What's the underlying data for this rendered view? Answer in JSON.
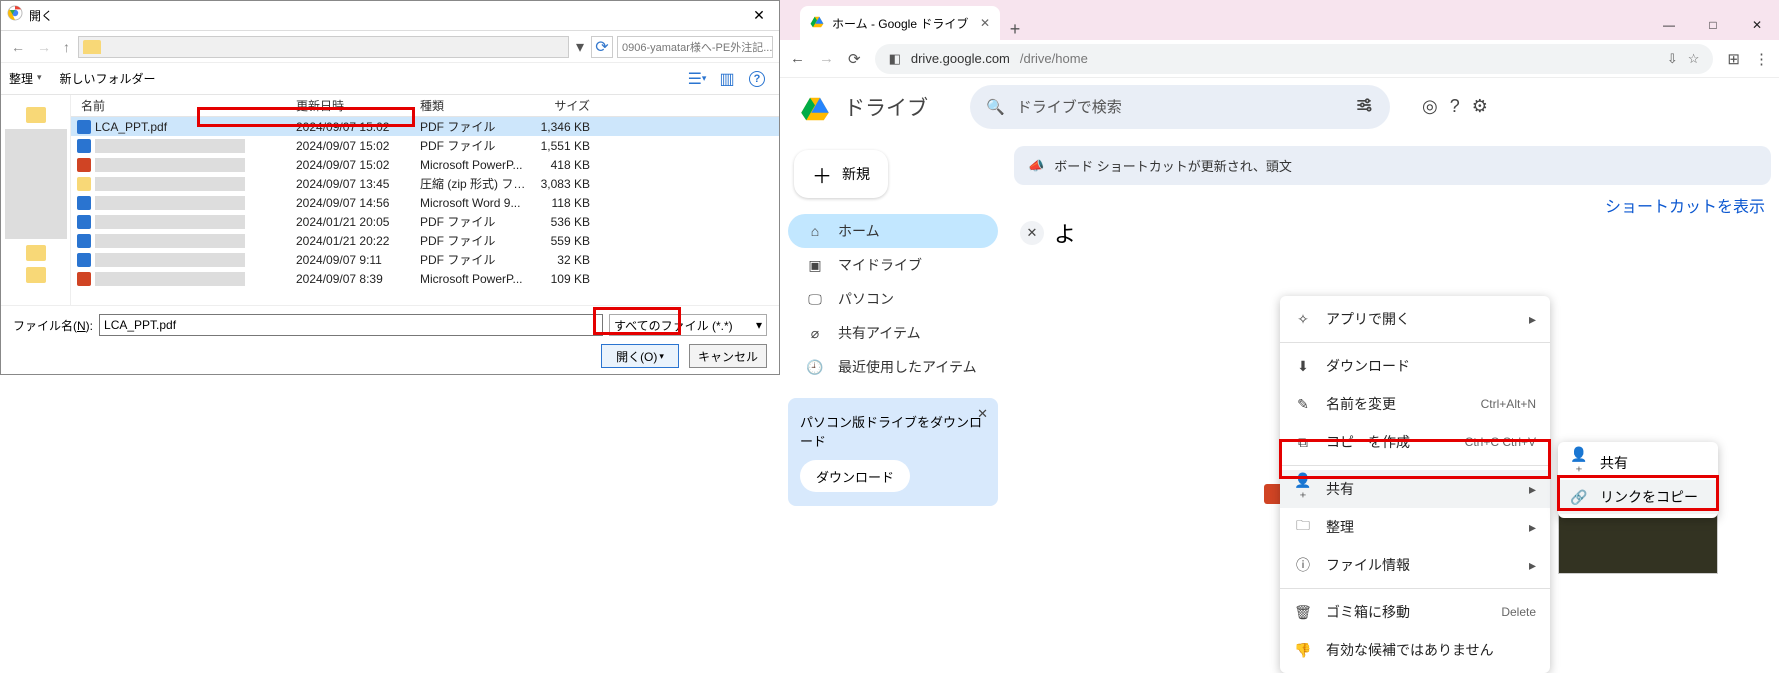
{
  "open_dialog": {
    "title": "開く",
    "nav": {
      "search_placeholder": "0906-yamatar様へ-PE外注記..."
    },
    "toolbar": {
      "organize": "整理",
      "new_folder": "新しいフォルダー"
    },
    "columns": {
      "name": "名前",
      "date": "更新日時",
      "type": "種類",
      "size": "サイズ"
    },
    "files": [
      {
        "name": "LCA_PPT.pdf",
        "date": "2024/09/07 15:02",
        "type": "PDF ファイル",
        "size": "1,346 KB",
        "ico": "pdf",
        "selected": true,
        "show_name": true
      },
      {
        "name": "",
        "date": "2024/09/07 15:02",
        "type": "PDF ファイル",
        "size": "1,551 KB",
        "ico": "pdf"
      },
      {
        "name": "",
        "date": "2024/09/07 15:02",
        "type": "Microsoft PowerP...",
        "size": "418 KB",
        "ico": "ppt"
      },
      {
        "name": "",
        "date": "2024/09/07 13:45",
        "type": "圧縮 (zip 形式) フォ...",
        "size": "3,083 KB",
        "ico": "zip"
      },
      {
        "name": "",
        "date": "2024/09/07 14:56",
        "type": "Microsoft Word 9...",
        "size": "118 KB",
        "ico": "doc"
      },
      {
        "name": "",
        "date": "2024/01/21 20:05",
        "type": "PDF ファイル",
        "size": "536 KB",
        "ico": "pdf"
      },
      {
        "name": "",
        "date": "2024/01/21 20:22",
        "type": "PDF ファイル",
        "size": "559 KB",
        "ico": "pdf"
      },
      {
        "name": "",
        "date": "2024/09/07 9:11",
        "type": "PDF ファイル",
        "size": "32 KB",
        "ico": "pdf"
      },
      {
        "name": "",
        "date": "2024/09/07 8:39",
        "type": "Microsoft PowerP...",
        "size": "109 KB",
        "ico": "ppt"
      }
    ],
    "footer": {
      "file_name_label": "ファイル名(N):",
      "file_name_value": "LCA_PPT.pdf",
      "type_filter": "すべてのファイル (*.*)",
      "open": "開く(O)",
      "cancel": "キャンセル"
    }
  },
  "chrome": {
    "tab_title": "ホーム - Google ドライブ",
    "url_host": "drive.google.com",
    "url_path": "/drive/home"
  },
  "drive": {
    "brand": "ドライブ",
    "search_placeholder": "ドライブで検索",
    "new_button": "新規",
    "side": [
      {
        "icon": "⌂",
        "label": "ホーム",
        "active": true
      },
      {
        "icon": "▣",
        "label": "マイドライブ"
      },
      {
        "icon": "🖵",
        "label": "パソコン"
      },
      {
        "icon": "⌀",
        "label": "共有アイテム"
      },
      {
        "icon": "🕘",
        "label": "最近使用したアイテム"
      }
    ],
    "promo": {
      "text": "パソコン版ドライブをダウンロード",
      "button": "ダウンロード"
    },
    "info_bar_tail": "ボード ショートカットが更新され、頭文",
    "shortcut_link": "ショートカットを表示",
    "welcome_prefix": "よ"
  },
  "ctx": {
    "open_with": "アプリで開く",
    "download": "ダウンロード",
    "rename": "名前を変更",
    "rename_kb": "Ctrl+Alt+N",
    "make_copy": "コピーを作成",
    "make_copy_kb": "Ctrl+C Ctrl+V",
    "share": "共有",
    "organize": "整理",
    "file_info": "ファイル情報",
    "trash": "ゴミ箱に移動",
    "trash_kb": "Delete",
    "no_suggest": "有効な候補ではありません"
  },
  "sub": {
    "share": "共有",
    "copy_link": "リンクをコピー"
  }
}
